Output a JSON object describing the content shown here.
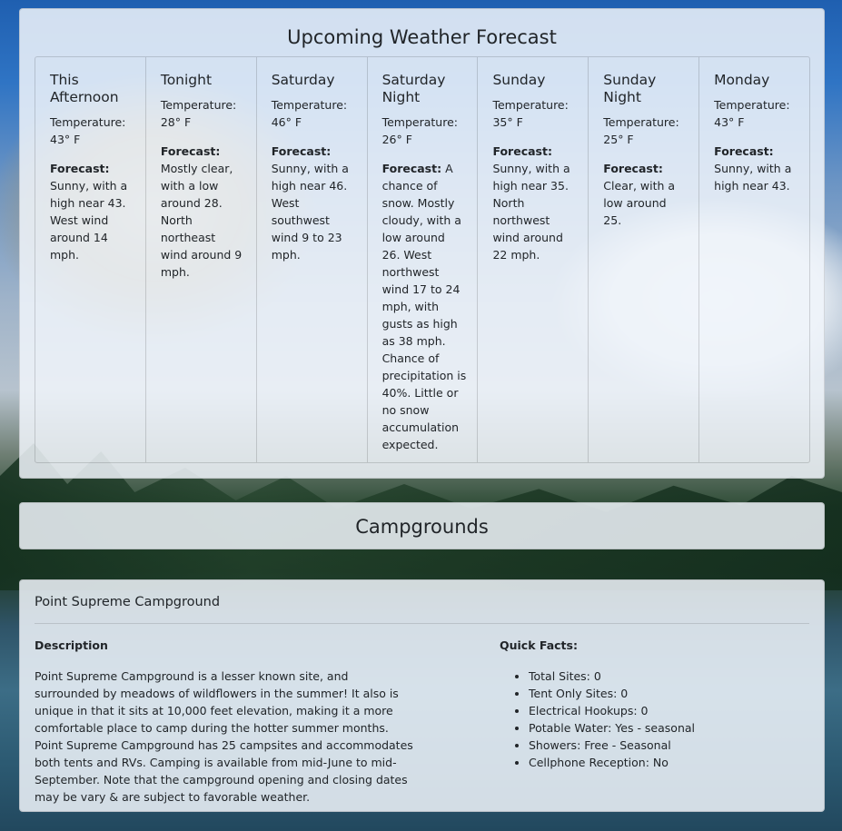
{
  "forecast": {
    "title": "Upcoming Weather Forecast",
    "forecast_label": "Forecast:",
    "periods": [
      {
        "name": "This Afternoon",
        "temperature": "Temperature: 43° F",
        "detail": "Sunny, with a high near 43. West wind around 14 mph."
      },
      {
        "name": "Tonight",
        "temperature": "Temperature: 28° F",
        "detail": "Mostly clear, with a low around 28. North northeast wind around 9 mph."
      },
      {
        "name": "Saturday",
        "temperature": "Temperature: 46° F",
        "detail": "Sunny, with a high near 46. West southwest wind 9 to 23 mph."
      },
      {
        "name": "Saturday Night",
        "temperature": "Temperature: 26° F",
        "detail": "A chance of snow. Mostly cloudy, with a low around 26. West northwest wind 17 to 24 mph, with gusts as high as 38 mph. Chance of precipitation is 40%. Little or no snow accumulation expected."
      },
      {
        "name": "Sunday",
        "temperature": "Temperature: 35° F",
        "detail": "Sunny, with a high near 35. North northwest wind around 22 mph."
      },
      {
        "name": "Sunday Night",
        "temperature": "Temperature: 25° F",
        "detail": "Clear, with a low around 25."
      },
      {
        "name": "Monday",
        "temperature": "Temperature: 43° F",
        "detail": "Sunny, with a high near 43."
      }
    ]
  },
  "campgrounds": {
    "title": "Campgrounds",
    "items": [
      {
        "name": "Point Supreme Campground",
        "description_title": "Description",
        "description": "Point Supreme Campground is a lesser known site, and surrounded by meadows of wildflowers in the summer! It also is unique in that it sits at 10,000 feet elevation, making it a more comfortable place to camp during the hotter summer months. Point Supreme Campground has 25 campsites and accommodates both tents and RVs. Camping is available from mid-June to mid-September. Note that the campground opening and closing dates may be vary & are subject to favorable weather.",
        "facts_title": "Quick Facts:",
        "facts": [
          "Total Sites: 0",
          "Tent Only Sites: 0",
          "Electrical Hookups: 0",
          "Potable Water: Yes - seasonal",
          "Showers: Free - Seasonal",
          "Cellphone Reception: No"
        ]
      }
    ]
  }
}
